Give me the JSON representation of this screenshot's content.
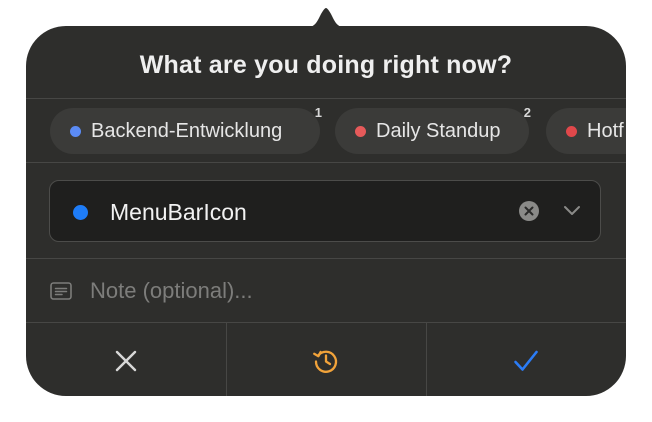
{
  "popover": {
    "title": "What are you doing right now?"
  },
  "recent_projects": [
    {
      "label": "Backend-Entwicklung",
      "shortcut": "1",
      "color": "#5b8bf5"
    },
    {
      "label": "Daily Standup",
      "shortcut": "2",
      "color": "#e65a5a"
    },
    {
      "label": "Hotf",
      "shortcut": "",
      "color": "#e0484b"
    }
  ],
  "project_select": {
    "value": "MenuBarIcon",
    "color": "#1e7cf7"
  },
  "note": {
    "placeholder": "Note (optional)..."
  },
  "actions": {
    "cancel_icon": "x-icon",
    "history_icon": "history-icon",
    "confirm_icon": "checkmark-icon",
    "history_color": "#f2a33a",
    "confirm_color": "#2b7cf6"
  }
}
